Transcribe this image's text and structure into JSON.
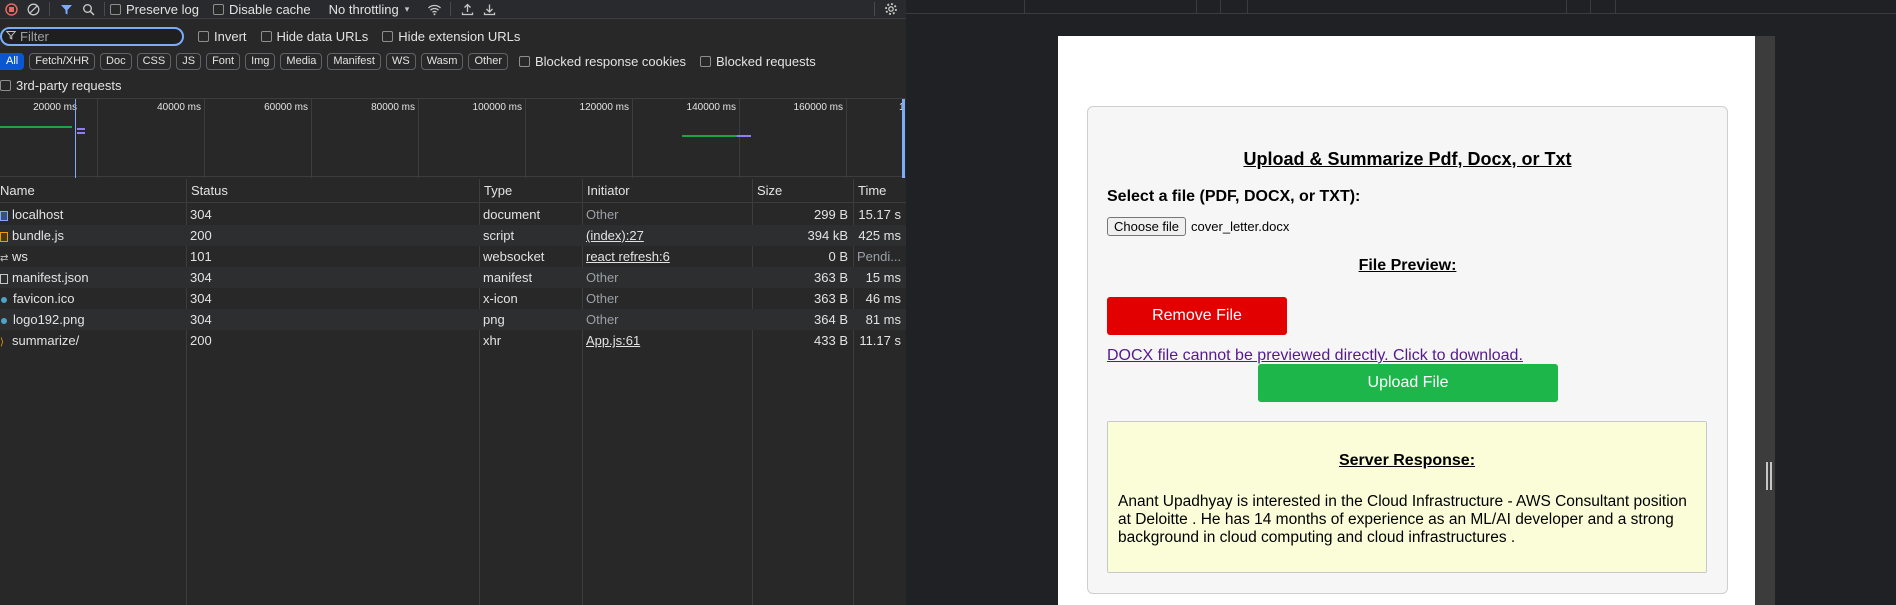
{
  "toolbar": {
    "preserve_log": "Preserve log",
    "disable_cache": "Disable cache",
    "throttling": "No throttling"
  },
  "filter": {
    "placeholder": "Filter",
    "invert": "Invert",
    "hide_data_urls": "Hide data URLs",
    "hide_extension_urls": "Hide extension URLs"
  },
  "type_filters": {
    "items": [
      "All",
      "Fetch/XHR",
      "Doc",
      "CSS",
      "JS",
      "Font",
      "Img",
      "Media",
      "Manifest",
      "WS",
      "Wasm",
      "Other"
    ],
    "active": "All",
    "blocked_response_cookies": "Blocked response cookies",
    "blocked_requests": "Blocked requests",
    "third_party": "3rd-party requests"
  },
  "overview": {
    "ticks": [
      "20000 ms",
      "40000 ms",
      "60000 ms",
      "80000 ms",
      "100000 ms",
      "120000 ms",
      "140000 ms",
      "160000 ms",
      "1"
    ]
  },
  "table": {
    "headers": {
      "name": "Name",
      "status": "Status",
      "type": "Type",
      "initiator": "Initiator",
      "size": "Size",
      "time": "Time"
    },
    "rows": [
      {
        "name": "localhost",
        "status": "304",
        "type": "document",
        "initiator": "Other",
        "size": "299 B",
        "time": "15.17 s"
      },
      {
        "name": "bundle.js",
        "status": "200",
        "type": "script",
        "initiator": "(index):27",
        "size": "394 kB",
        "time": "425 ms"
      },
      {
        "name": "ws",
        "status": "101",
        "type": "websocket",
        "initiator": "react refresh:6",
        "size": "0 B",
        "time": "Pendi..."
      },
      {
        "name": "manifest.json",
        "status": "304",
        "type": "manifest",
        "initiator": "Other",
        "size": "363 B",
        "time": "15 ms"
      },
      {
        "name": "favicon.ico",
        "status": "304",
        "type": "x-icon",
        "initiator": "Other",
        "size": "363 B",
        "time": "46 ms"
      },
      {
        "name": "logo192.png",
        "status": "304",
        "type": "png",
        "initiator": "Other",
        "size": "364 B",
        "time": "81 ms"
      },
      {
        "name": "summarize/",
        "status": "200",
        "type": "xhr",
        "initiator": "App.js:61",
        "size": "433 B",
        "time": "11.17 s"
      }
    ]
  },
  "page": {
    "title": "Upload & Summarize Pdf, Docx, or Txt",
    "select_label": "Select a file (PDF, DOCX, or TXT):",
    "choose_button": "Choose file",
    "chosen_file": "cover_letter.docx",
    "preview_heading": "File Preview:",
    "remove_button": "Remove File",
    "download_link": "DOCX file cannot be previewed directly. Click to download.",
    "upload_button": "Upload File",
    "response_heading": "Server Response:",
    "response_text": "Anant Upadhyay is interested in the Cloud Infrastructure - AWS Consultant position at Deloitte . He has 14 months of experience as an ML/AI developer and a strong background in cloud computing and cloud infrastructures ."
  }
}
